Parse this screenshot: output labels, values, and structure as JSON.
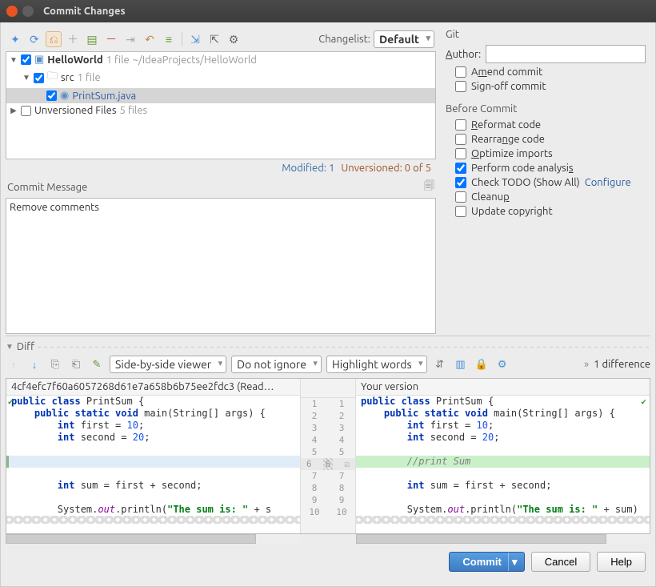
{
  "window": {
    "title": "Commit Changes"
  },
  "toolbar": {
    "changelist_label": "Changelist:",
    "changelist_value": "Default"
  },
  "tree": {
    "root": {
      "name": "HelloWorld",
      "meta1": "1 file",
      "meta2": "~/IdeaProjects/HelloWorld",
      "checked": true
    },
    "src": {
      "name": "src",
      "meta": "1 file",
      "checked": true
    },
    "file": {
      "name": "PrintSum.java",
      "checked": true
    },
    "unversioned": {
      "name": "Unversioned Files",
      "meta": "5 files",
      "checked": false
    }
  },
  "status": {
    "modified": "Modified: 1",
    "unversioned": "Unversioned: 0 of 5"
  },
  "commit_msg": {
    "label": "Commit Message",
    "value": "Remove comments"
  },
  "vcs": {
    "section": "Git",
    "author_label": "Author:",
    "author_value": "",
    "amend": "Amend commit",
    "signoff": "Sign-off commit"
  },
  "before": {
    "section": "Before Commit",
    "reformat": "Reformat code",
    "rearrange": "Rearrange code",
    "optimize": "Optimize imports",
    "analysis": "Perform code analysis",
    "todo": "Check TODO (Show All)",
    "todo_link": "Configure",
    "cleanup": "Cleanup",
    "copyright": "Update copyright"
  },
  "diff": {
    "header": "Diff",
    "viewer": "Side-by-side viewer",
    "ignore": "Do not ignore",
    "highlight": "Highlight words",
    "count": "1 difference",
    "left_title": "4cf4efc7f60a6057268d61e7a658b6b75ee2fdc3 (Read…",
    "right_title": "Your version",
    "lines": {
      "l1": "public class PrintSum {",
      "l2": "    public static void main(String[] args) {",
      "l3": "        int first = 10;",
      "l4": "        int second = 20;",
      "l5": "",
      "l6l": "",
      "l6r": "        //print Sum",
      "l7": "",
      "l8": "        int sum = first + second;",
      "l9": "",
      "l10l": "        System.out.println(\"The sum is: \" + s",
      "l10r": "        System.out.println(\"The sum is: \" + sum)"
    }
  },
  "footer": {
    "commit": "Commit",
    "cancel": "Cancel",
    "help": "Help"
  }
}
